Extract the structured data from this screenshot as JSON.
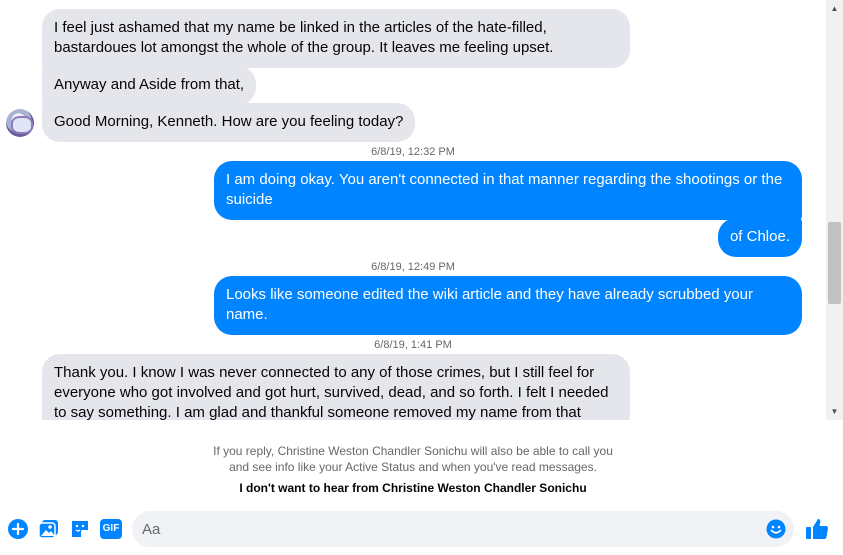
{
  "thread": {
    "messages": [
      {
        "dir": "in",
        "text": "I feel just ashamed that my name be linked in the articles of the hate-filled, bastardoues lot amongst the whole of the group. It leaves me feeling upset."
      },
      {
        "dir": "in",
        "text": "Anyway and Aside from that,"
      },
      {
        "dir": "in",
        "text": "Good Morning, Kenneth.  How are you feeling today?"
      },
      {
        "dir": "out",
        "text": "I am doing okay. You aren't connected in that manner regarding the shootings or the suicide"
      },
      {
        "dir": "out",
        "text": "of Chloe."
      },
      {
        "dir": "out",
        "text": "Looks like someone edited the wiki article and they have already scrubbed your name."
      },
      {
        "dir": "in",
        "text": "Thank you.  I know I was never connected to any of those crimes, but I still feel for everyone who got involved and got hurt, survived, dead, and so forth.  I felt I needed to say something.  I am glad and thankful someone removed my name from that"
      }
    ],
    "timestamps": [
      "6/8/19, 12:32 PM",
      "6/8/19, 12:49 PM",
      "6/8/19, 1:41 PM"
    ]
  },
  "notice": {
    "line1": "If you reply, Christine Weston Chandler Sonichu will also be able to call you",
    "line2": "and see info like your Active Status and when you've read messages.",
    "block_label": "I don't want to hear from Christine Weston Chandler Sonichu"
  },
  "composer": {
    "placeholder": "Aa",
    "value": "",
    "gif_label": "GIF",
    "icons": [
      "plus-circle-icon",
      "image-icon",
      "sticker-icon",
      "gif-icon",
      "emoji-icon",
      "thumbs-up-icon"
    ]
  },
  "colors": {
    "accent": "#0084ff",
    "incoming": "#e4e6eb",
    "icon_blue": "#0084ff"
  }
}
